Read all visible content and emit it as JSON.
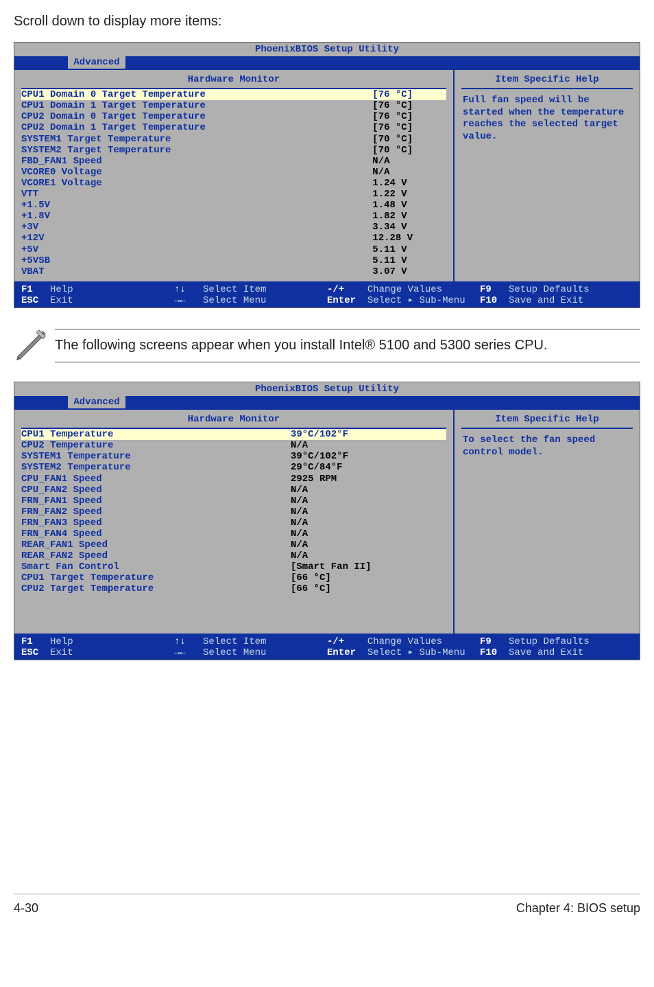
{
  "page": {
    "intro": "Scroll down to display more items:",
    "note": "The following screens appear when you install Intel® 5100 and 5300 series CPU.",
    "footer_left": "4-30",
    "footer_right": "Chapter 4: BIOS setup"
  },
  "bios1": {
    "title": "PhoenixBIOS Setup Utility",
    "tab": "Advanced",
    "heading": "Hardware Monitor",
    "help_title": "Item Specific Help",
    "help_text": "Full fan speed will be started when the temperature reaches the selected target value.",
    "highlight_row": {
      "label": "CPU1 Domain 0 Target Temperature",
      "val": "[76 °C]"
    },
    "rows": [
      {
        "label": "CPU1 Domain 1 Target Temperature",
        "val": "[76 °C]"
      },
      {
        "label": "CPU2 Domain 0 Target Temperature",
        "val": "[76 °C]"
      },
      {
        "label": "CPU2 Domain 1 Target Temperature",
        "val": "[76 °C]"
      },
      {
        "label": "SYSTEM1 Target Temperature",
        "val": "[70 °C]"
      },
      {
        "label": "SYSTEM2 Target Temperature",
        "val": "[70 °C]"
      },
      {
        "label": "",
        "val": ""
      },
      {
        "label": "FBD_FAN1 Speed",
        "val": "N/A"
      },
      {
        "label": "VCORE0 Voltage",
        "val": "N/A"
      },
      {
        "label": "VCORE1 Voltage",
        "val": "1.24 V"
      },
      {
        "label": "VTT",
        "val": "1.22 V"
      },
      {
        "label": "+1.5V",
        "val": "1.48 V"
      },
      {
        "label": "+1.8V",
        "val": "1.82 V"
      },
      {
        "label": "+3V",
        "val": "3.34 V"
      },
      {
        "label": "+12V",
        "val": "12.28 V"
      },
      {
        "label": "+5V",
        "val": "5.11 V"
      },
      {
        "label": "+5VSB",
        "val": "5.11 V"
      },
      {
        "label": "VBAT",
        "val": "3.07 V"
      }
    ],
    "footer": {
      "k1": "F1",
      "l1": "Help",
      "k2": "ESC",
      "l2": "Exit",
      "n1": "↑↓",
      "m1": "Select Item",
      "n2": "→←",
      "m2": "Select Menu",
      "k3": "-/+",
      "l3": "Change Values",
      "k4": "Enter",
      "l4": "Select ▸ Sub-Menu",
      "k5": "F9",
      "l5": "Setup Defaults",
      "k6": "F10",
      "l6": "Save and Exit"
    }
  },
  "bios2": {
    "title": "PhoenixBIOS Setup Utility",
    "tab": "Advanced",
    "heading": "Hardware Monitor",
    "help_title": "Item Specific Help",
    "help_text": "To select the fan speed control model.",
    "highlight_row": {
      "label": "CPU1 Temperature",
      "val": "39°C/102°F"
    },
    "rows": [
      {
        "label": "CPU2 Temperature",
        "val": "N/A"
      },
      {
        "label": "SYSTEM1 Temperature",
        "val": "39°C/102°F"
      },
      {
        "label": "SYSTEM2 Temperature",
        "val": "29°C/84°F"
      },
      {
        "label": "CPU_FAN1 Speed",
        "val": "2925 RPM"
      },
      {
        "label": "CPU_FAN2 Speed",
        "val": "N/A"
      },
      {
        "label": "FRN_FAN1 Speed",
        "val": "N/A"
      },
      {
        "label": "FRN_FAN2 Speed",
        "val": "N/A"
      },
      {
        "label": "FRN_FAN3 Speed",
        "val": "N/A"
      },
      {
        "label": "FRN_FAN4 Speed",
        "val": "N/A"
      },
      {
        "label": "REAR_FAN1 Speed",
        "val": "N/A"
      },
      {
        "label": "REAR_FAN2 Speed",
        "val": "N/A"
      },
      {
        "label": "Smart Fan Control",
        "val": "[Smart Fan II]"
      },
      {
        "label": "CPU1 Target Temperature",
        "val": "[66 °C]"
      },
      {
        "label": "CPU2 Target Temperature",
        "val": "[66 °C]"
      }
    ],
    "footer": {
      "k1": "F1",
      "l1": "Help",
      "k2": "ESC",
      "l2": "Exit",
      "n1": "↑↓",
      "m1": "Select Item",
      "n2": "→←",
      "m2": "Select Menu",
      "k3": "-/+",
      "l3": "Change Values",
      "k4": "Enter",
      "l4": "Select ▸ Sub-Menu",
      "k5": "F9",
      "l5": "Setup Defaults",
      "k6": "F10",
      "l6": "Save and Exit"
    }
  }
}
